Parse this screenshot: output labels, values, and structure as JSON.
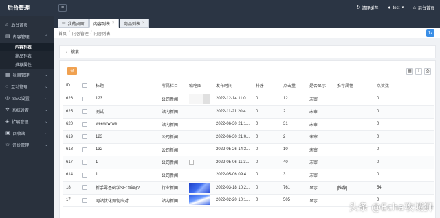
{
  "app": {
    "title": "后台管理"
  },
  "topbar": {
    "clear_cache": "清理缓存",
    "user": "test",
    "frontend": "前台首页"
  },
  "sidebar": {
    "items": [
      {
        "label": "后台首页",
        "icon": "home-icon"
      },
      {
        "label": "内容管理",
        "icon": "folder-icon"
      },
      {
        "label": "栏目管理",
        "icon": "columns-icon"
      },
      {
        "label": "互动管理",
        "icon": "chat-icon"
      },
      {
        "label": "SEO设置",
        "icon": "seo-icon"
      },
      {
        "label": "系统设置",
        "icon": "gear-icon"
      },
      {
        "label": "扩展管理",
        "icon": "extension-icon"
      },
      {
        "label": "回收站",
        "icon": "trash-icon"
      },
      {
        "label": "评价管理",
        "icon": "star-icon"
      }
    ],
    "sub_items": [
      "内容列表",
      "商品列表",
      "推荐属性"
    ]
  },
  "tabs": [
    {
      "label": "我的桌面"
    },
    {
      "label": "内容列表"
    },
    {
      "label": "商品列表"
    }
  ],
  "breadcrumb": [
    "首页",
    "内容管理",
    "内容列表"
  ],
  "search": {
    "label": "搜索"
  },
  "table": {
    "headers": [
      "ID",
      "",
      "标题",
      "所属栏目",
      "缩略图",
      "发布时间",
      "排序",
      "点击量",
      "是否显示",
      "推荐属性",
      "点赞数"
    ],
    "rows": [
      {
        "id": "626",
        "title": "123",
        "column": "公司新闻",
        "thumb": "blank",
        "time": "2022-12-14 11:0...",
        "sort": "0",
        "clicks": "12",
        "show": "未审",
        "recommend": "",
        "likes": "0"
      },
      {
        "id": "625",
        "title": "测试",
        "column": "站内新闻",
        "thumb": "none",
        "time": "2022-11-21 20:4...",
        "sort": "0",
        "clicks": "2",
        "show": "未审",
        "recommend": "",
        "likes": "0"
      },
      {
        "id": "620",
        "title": "weewrwrwe",
        "column": "站内新闻",
        "thumb": "none",
        "time": "2022-06-30 21:1...",
        "sort": "0",
        "clicks": "31",
        "show": "未审",
        "recommend": "",
        "likes": "0"
      },
      {
        "id": "619",
        "title": "123",
        "column": "公司新闻",
        "thumb": "none",
        "time": "2022-06-30 21:0...",
        "sort": "0",
        "clicks": "2",
        "show": "未审",
        "recommend": "",
        "likes": "0"
      },
      {
        "id": "618",
        "title": "132",
        "column": "公司新闻",
        "thumb": "none",
        "time": "2022-05-26 14:3...",
        "sort": "0",
        "clicks": "10",
        "show": "未审",
        "recommend": "",
        "likes": "0"
      },
      {
        "id": "617",
        "title": "1",
        "column": "公司新闻",
        "thumb": "broken",
        "time": "2022-05-06 11:3...",
        "sort": "0",
        "clicks": "40",
        "show": "未审",
        "recommend": "",
        "likes": "0"
      },
      {
        "id": "614",
        "title": "1",
        "column": "公司新闻",
        "thumb": "none",
        "time": "2022-05-06 09:4...",
        "sort": "0",
        "clicks": "3",
        "show": "未审",
        "recommend": "",
        "likes": "0"
      },
      {
        "id": "18",
        "title": "新手零基础学SEO难吗?",
        "column": "行业新闻",
        "thumb": "blue",
        "time": "2022-03-18 10:2...",
        "sort": "0",
        "clicks": "761",
        "show": "显示",
        "recommend": "[推荐]",
        "likes": "54"
      },
      {
        "id": "17",
        "title": "网站优化如何应对...",
        "column": "站内新闻",
        "thumb": "blue2",
        "time": "2022-02-20 10:1...",
        "sort": "0",
        "clicks": "505",
        "show": "显示",
        "recommend": "",
        "likes": "0"
      }
    ]
  },
  "watermark": "头条 @Echa攻城狮"
}
